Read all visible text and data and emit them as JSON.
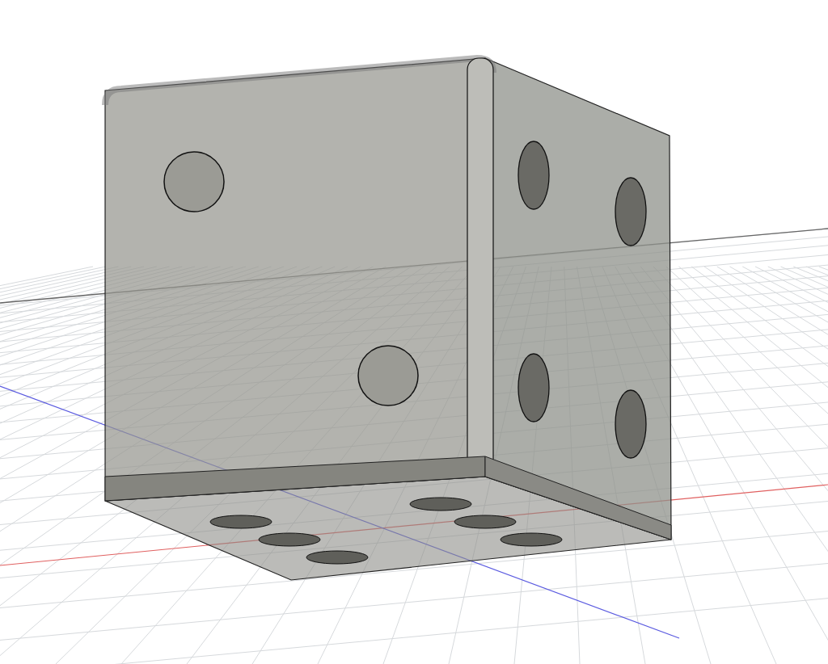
{
  "viewport": {
    "show_grid": true,
    "show_axes": true
  },
  "model": {
    "kind": "die"
  }
}
